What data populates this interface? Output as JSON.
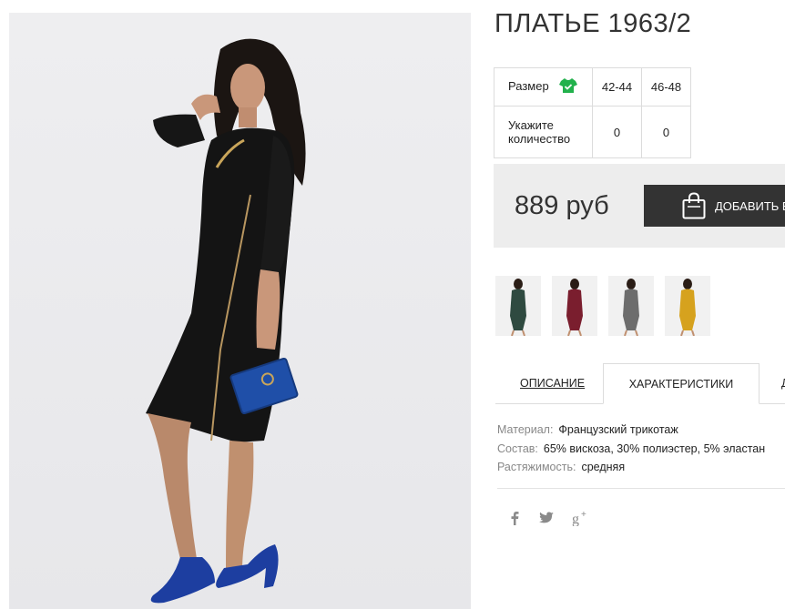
{
  "product": {
    "title": "ПЛАТЬЕ 1963/2",
    "image_alt": "black dress with diagonal zipper slit, model holding blue clutch"
  },
  "size_table": {
    "size_label": "Размер",
    "size_icon": "t-shirt-icon",
    "quantity_label_line1": "Укажите",
    "quantity_label_line2": "количество",
    "sizes": [
      {
        "size": "42-44",
        "quantity": "0"
      },
      {
        "size": "46-48",
        "quantity": "0"
      }
    ]
  },
  "purchase": {
    "price": "889 руб",
    "add_button_label": "ДОБАВИТЬ В",
    "bag_icon": "shopping-bag-icon"
  },
  "color_variants": [
    {
      "color": "#2f4a40"
    },
    {
      "color": "#7a1e2e"
    },
    {
      "color": "#6d6d6d"
    },
    {
      "color": "#d6a21e"
    }
  ],
  "tabs": {
    "description": "ОПИСАНИЕ",
    "characteristics": "ХАРАКТЕРИСТИКИ",
    "more": "Д"
  },
  "specs": [
    {
      "key": "Материал:",
      "value": "Французский трикотаж"
    },
    {
      "key": "Состав:",
      "value": "65% вискоза, 30% полиэстер, 5% эластан"
    },
    {
      "key": "Растяжимость:",
      "value": "средняя"
    }
  ],
  "social": [
    "facebook-icon",
    "twitter-icon",
    "google-plus-icon"
  ],
  "colors": {
    "accent_green": "#22b14c",
    "button_dark": "#333333",
    "price_box": "#ededed"
  }
}
